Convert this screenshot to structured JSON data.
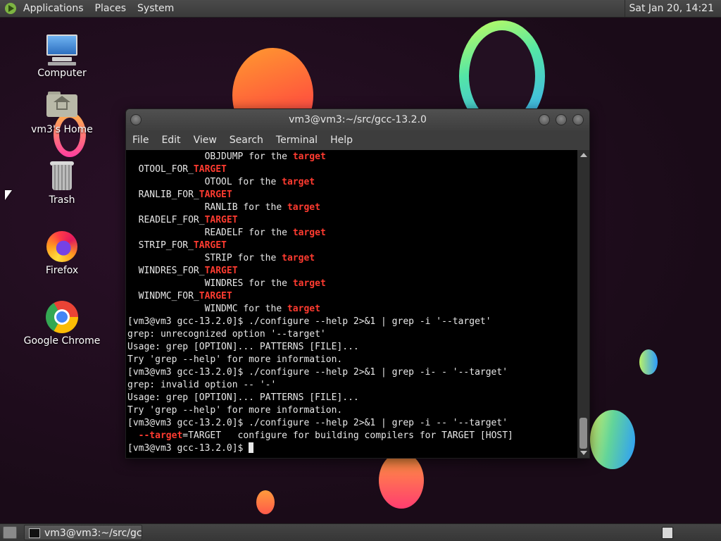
{
  "top_panel": {
    "menus": [
      "Applications",
      "Places",
      "System"
    ],
    "clock": "Sat Jan 20, 14:21"
  },
  "desktop_icons": [
    {
      "label": "Computer",
      "icon": "computer-icon"
    },
    {
      "label": "vm3's Home",
      "icon": "home-folder-icon"
    },
    {
      "label": "Trash",
      "icon": "trash-icon"
    },
    {
      "label": "Firefox",
      "icon": "firefox-icon"
    },
    {
      "label": "Google Chrome",
      "icon": "chrome-icon"
    }
  ],
  "terminal": {
    "title": "vm3@vm3:~/src/gcc-13.2.0",
    "menu": [
      "File",
      "Edit",
      "View",
      "Search",
      "Terminal",
      "Help"
    ],
    "lines": [
      {
        "parts": [
          {
            "t": "              OBJDUMP for the "
          },
          {
            "t": "target",
            "hl": true
          }
        ]
      },
      {
        "parts": [
          {
            "t": "  OTOOL_FOR_"
          },
          {
            "t": "TARGET",
            "hl": true
          }
        ]
      },
      {
        "parts": [
          {
            "t": "              OTOOL for the "
          },
          {
            "t": "target",
            "hl": true
          }
        ]
      },
      {
        "parts": [
          {
            "t": "  RANLIB_FOR_"
          },
          {
            "t": "TARGET",
            "hl": true
          }
        ]
      },
      {
        "parts": [
          {
            "t": "              RANLIB for the "
          },
          {
            "t": "target",
            "hl": true
          }
        ]
      },
      {
        "parts": [
          {
            "t": "  READELF_FOR_"
          },
          {
            "t": "TARGET",
            "hl": true
          }
        ]
      },
      {
        "parts": [
          {
            "t": "              READELF for the "
          },
          {
            "t": "target",
            "hl": true
          }
        ]
      },
      {
        "parts": [
          {
            "t": "  STRIP_FOR_"
          },
          {
            "t": "TARGET",
            "hl": true
          }
        ]
      },
      {
        "parts": [
          {
            "t": "              STRIP for the "
          },
          {
            "t": "target",
            "hl": true
          }
        ]
      },
      {
        "parts": [
          {
            "t": "  WINDRES_FOR_"
          },
          {
            "t": "TARGET",
            "hl": true
          }
        ]
      },
      {
        "parts": [
          {
            "t": "              WINDRES for the "
          },
          {
            "t": "target",
            "hl": true
          }
        ]
      },
      {
        "parts": [
          {
            "t": "  WINDMC_FOR_"
          },
          {
            "t": "TARGET",
            "hl": true
          }
        ]
      },
      {
        "parts": [
          {
            "t": "              WINDMC for the "
          },
          {
            "t": "target",
            "hl": true
          }
        ]
      },
      {
        "parts": [
          {
            "t": "[vm3@vm3 gcc-13.2.0]$ ./configure --help 2>&1 | grep -i '--target'"
          }
        ]
      },
      {
        "parts": [
          {
            "t": "grep: unrecognized option '--target'"
          }
        ]
      },
      {
        "parts": [
          {
            "t": "Usage: grep [OPTION]... PATTERNS [FILE]..."
          }
        ]
      },
      {
        "parts": [
          {
            "t": "Try 'grep --help' for more information."
          }
        ]
      },
      {
        "parts": [
          {
            "t": "[vm3@vm3 gcc-13.2.0]$ ./configure --help 2>&1 | grep -i- - '--target'"
          }
        ]
      },
      {
        "parts": [
          {
            "t": "grep: invalid option -- '-'"
          }
        ]
      },
      {
        "parts": [
          {
            "t": "Usage: grep [OPTION]... PATTERNS [FILE]..."
          }
        ]
      },
      {
        "parts": [
          {
            "t": "Try 'grep --help' for more information."
          }
        ]
      },
      {
        "parts": [
          {
            "t": "[vm3@vm3 gcc-13.2.0]$ ./configure --help 2>&1 | grep -i -- '--target'"
          }
        ]
      },
      {
        "parts": [
          {
            "t": "  "
          },
          {
            "t": "--target",
            "hl": true
          },
          {
            "t": "=TARGET   configure for building compilers for TARGET [HOST]"
          }
        ]
      },
      {
        "parts": [
          {
            "t": "[vm3@vm3 gcc-13.2.0]$ "
          }
        ],
        "cursor": true
      }
    ]
  },
  "taskbar": {
    "window_button": "vm3@vm3:~/src/gc..."
  },
  "colors": {
    "terminal_highlight": "#ff3b30",
    "terminal_bg": "#000000",
    "panel_bg": "#3f3f3f"
  }
}
